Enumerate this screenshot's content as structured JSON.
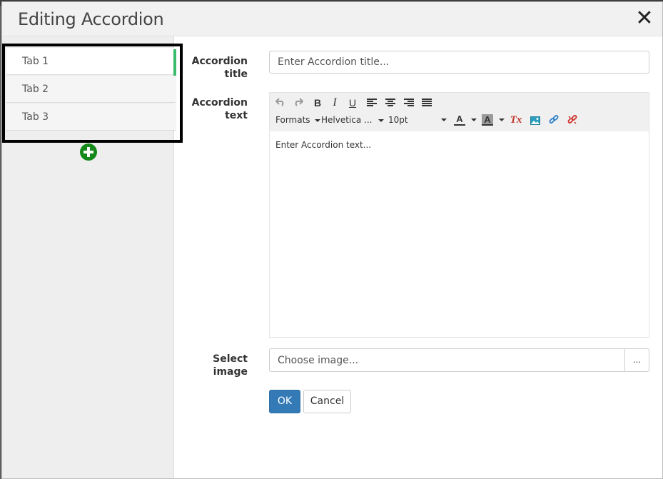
{
  "dialog": {
    "title": "Editing Accordion",
    "close_label": "✕"
  },
  "sidebar": {
    "tabs": [
      {
        "label": "Tab 1",
        "active": true
      },
      {
        "label": "Tab 2",
        "active": false
      },
      {
        "label": "Tab 3",
        "active": false
      }
    ],
    "active_color": "#3dbb6c",
    "add_color": "#14891a"
  },
  "form": {
    "title_label_1": "Accordion",
    "title_label_2": "title",
    "title_placeholder": "Enter Accordion title...",
    "text_label_1": "Accordion",
    "text_label_2": "text",
    "image_label_1": "Select",
    "image_label_2": "image",
    "image_placeholder": "Choose image...",
    "browse_label": "...",
    "ok_label": "OK",
    "cancel_label": "Cancel",
    "ok_color": "#337ab7"
  },
  "editor": {
    "formats_label": "Formats",
    "font_label": "Helvetica ...",
    "size_label": "10pt",
    "body_text": "Enter Accordion text...",
    "bold_label": "B",
    "italic_label": "I",
    "underline_label": "U",
    "text_color_label": "A",
    "bg_color_label": "A",
    "clear_format_label": "Tx",
    "icons": [
      "undo-icon",
      "redo-icon",
      "bold-icon",
      "italic-icon",
      "underline-icon",
      "align-left-icon",
      "align-center-icon",
      "align-right-icon",
      "align-justify-icon",
      "text-color-icon",
      "background-color-icon",
      "clear-formatting-icon",
      "image-icon",
      "link-icon",
      "unlink-icon"
    ]
  }
}
